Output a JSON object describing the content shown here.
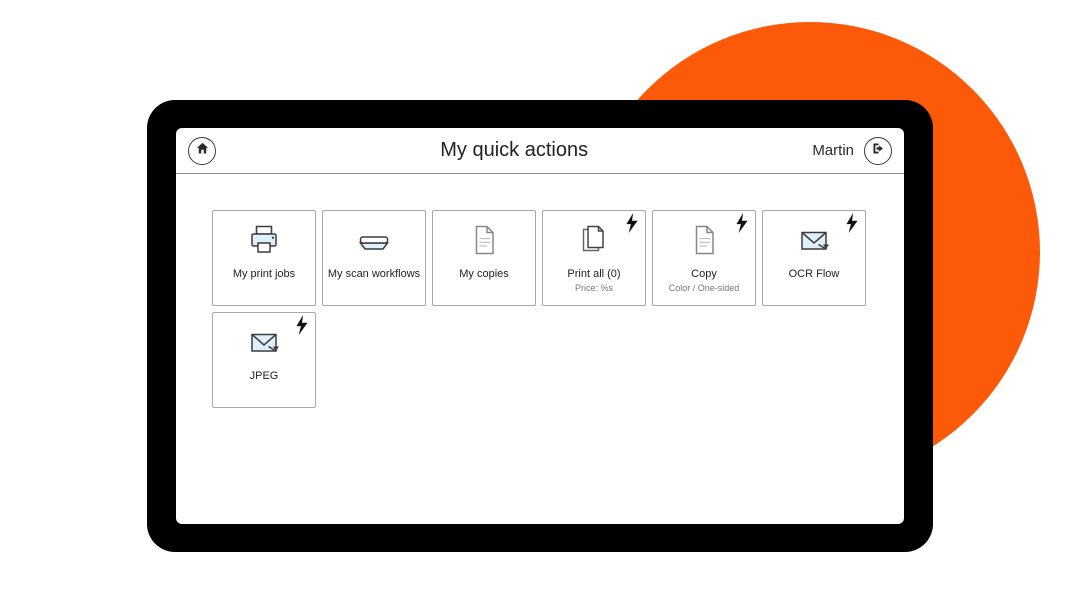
{
  "header": {
    "title": "My quick actions",
    "user": "Martin"
  },
  "tiles": [
    {
      "id": "my-print-jobs",
      "label": "My print jobs",
      "sub": "",
      "icon": "printer",
      "bolt": false
    },
    {
      "id": "my-scan-workflows",
      "label": "My scan workflows",
      "sub": "",
      "icon": "scanner",
      "bolt": false
    },
    {
      "id": "my-copies",
      "label": "My copies",
      "sub": "",
      "icon": "doc",
      "bolt": false
    },
    {
      "id": "print-all",
      "label": "Print all (0)",
      "sub": "Price: %s",
      "icon": "docs",
      "bolt": true
    },
    {
      "id": "copy",
      "label": "Copy",
      "sub": "Color / One-sided",
      "icon": "doc",
      "bolt": true
    },
    {
      "id": "ocr-flow",
      "label": "OCR Flow",
      "sub": "",
      "icon": "envelope",
      "bolt": true
    },
    {
      "id": "jpeg",
      "label": "JPEG",
      "sub": "",
      "icon": "envelope",
      "bolt": true
    }
  ]
}
